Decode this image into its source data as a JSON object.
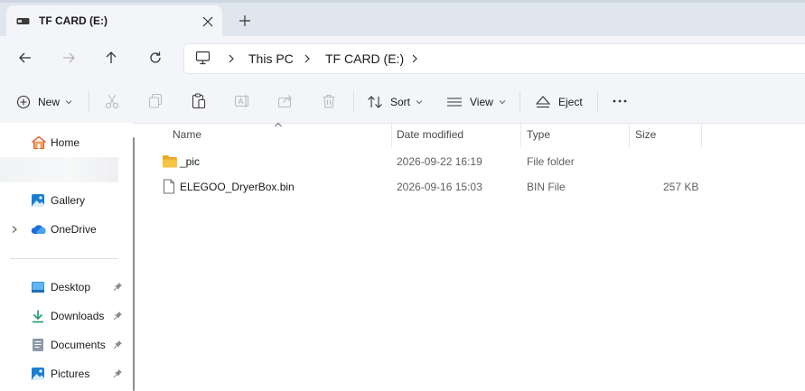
{
  "tab": {
    "title": "TF CARD (E:)"
  },
  "breadcrumb": [
    "This PC",
    "TF CARD (E:)"
  ],
  "toolbar": {
    "new": "New",
    "sort": "Sort",
    "view": "View",
    "eject": "Eject"
  },
  "sidebar": {
    "home": "Home",
    "gallery": "Gallery",
    "onedrive": "OneDrive",
    "quick": [
      {
        "label": "Desktop",
        "icon": "desktop-icon"
      },
      {
        "label": "Downloads",
        "icon": "downloads-icon"
      },
      {
        "label": "Documents",
        "icon": "documents-icon"
      },
      {
        "label": "Pictures",
        "icon": "pictures-icon"
      }
    ]
  },
  "columns": {
    "name": "Name",
    "date": "Date modified",
    "type": "Type",
    "size": "Size"
  },
  "files": [
    {
      "name": "_pic",
      "date": "2026-09-22 16:19",
      "type": "File folder",
      "size": ""
    },
    {
      "name": "ELEGOO_DryerBox.bin",
      "date": "2026-09-16 15:03",
      "type": "BIN File",
      "size": "257 KB"
    }
  ],
  "colors": {
    "accent": "#0067c0",
    "folder": "#f6c342",
    "tabbar": "#dfe6ee",
    "panel": "#f3f5f8"
  }
}
